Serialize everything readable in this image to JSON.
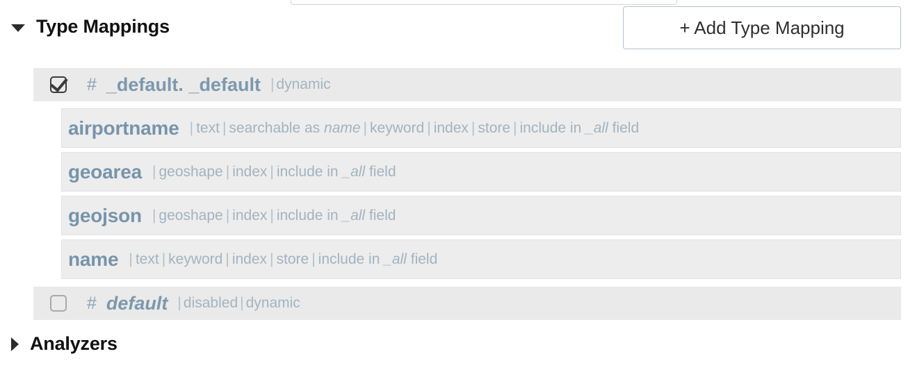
{
  "top_cut_input": {
    "value": "",
    "placeholder": ""
  },
  "toolbar": {
    "add_type_mapping_label": "+ Add Type Mapping"
  },
  "sections": {
    "type_mappings": {
      "title": "Type Mappings",
      "expanded": true,
      "disclosure_icon": "triangle-down-icon"
    },
    "analyzers": {
      "title": "Analyzers",
      "expanded": false,
      "disclosure_icon": "triangle-right-icon"
    }
  },
  "type_mappings": [
    {
      "checkbox_icon": "checkbox-checked-icon",
      "checked": true,
      "hash": "#",
      "name": "_default. _default",
      "italic": false,
      "attrs": [
        {
          "sep": "|",
          "text": "dynamic"
        }
      ]
    },
    {
      "checkbox_icon": "checkbox-unchecked-icon",
      "checked": false,
      "hash": "#",
      "name": "default",
      "italic": true,
      "attrs": [
        {
          "sep": "|",
          "text": "disabled"
        },
        {
          "sep": "|",
          "text": "dynamic"
        }
      ]
    }
  ],
  "fields": [
    {
      "name": "airportname",
      "attrs": [
        {
          "sep": "|",
          "text": "text"
        },
        {
          "sep": "|",
          "text": "searchable as ",
          "em": "name"
        },
        {
          "sep": "|",
          "text": "keyword"
        },
        {
          "sep": "|",
          "text": "index"
        },
        {
          "sep": "|",
          "text": "store"
        },
        {
          "sep": "|",
          "text": "include in ",
          "em": "_all",
          "tail": " field"
        }
      ]
    },
    {
      "name": "geoarea",
      "attrs": [
        {
          "sep": "|",
          "text": "geoshape"
        },
        {
          "sep": "|",
          "text": "index"
        },
        {
          "sep": "|",
          "text": "include in ",
          "em": "_all",
          "tail": " field"
        }
      ]
    },
    {
      "name": "geojson",
      "attrs": [
        {
          "sep": "|",
          "text": "geoshape"
        },
        {
          "sep": "|",
          "text": "index"
        },
        {
          "sep": "|",
          "text": "include in ",
          "em": "_all",
          "tail": " field"
        }
      ]
    },
    {
      "name": "name",
      "attrs": [
        {
          "sep": "|",
          "text": "text"
        },
        {
          "sep": "|",
          "text": "keyword"
        },
        {
          "sep": "|",
          "text": "index"
        },
        {
          "sep": "|",
          "text": "store"
        },
        {
          "sep": "|",
          "text": "include in ",
          "em": "_all",
          "tail": " field"
        }
      ]
    }
  ],
  "colors": {
    "row_background": "#eaeaea",
    "field_row_background": "#ededed",
    "field_name": "#7794ab",
    "attr_text": "#a2b3c0",
    "heading": "#111111",
    "button_border": "#b7c0cc"
  }
}
